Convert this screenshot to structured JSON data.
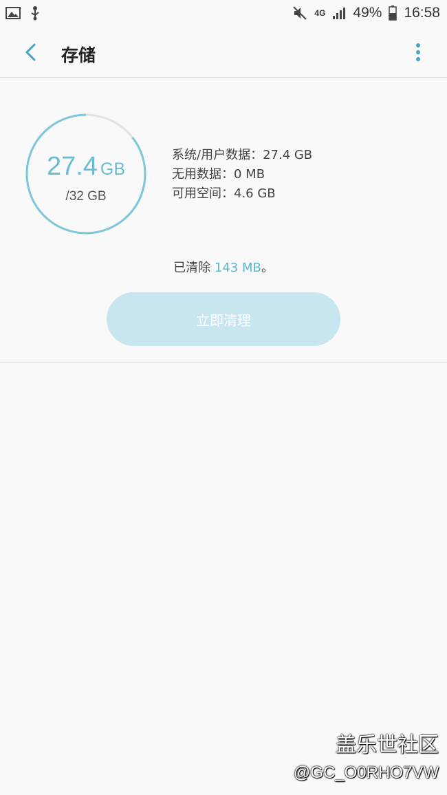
{
  "status_bar": {
    "network": "4G",
    "battery": "49%",
    "time": "16:58",
    "icons": [
      "image-icon",
      "usb-debug-icon",
      "mute-icon",
      "signal-icon",
      "battery-icon"
    ]
  },
  "header": {
    "title": "存储",
    "back_icon": "chevron-left-icon",
    "more_icon": "more-vertical-icon",
    "accent_color": "#4a9fc4"
  },
  "storage": {
    "used_number": "27.4",
    "used_unit": "GB",
    "total": "/32 GB",
    "used_fraction": 0.856,
    "ring_color": "#7ec6db",
    "ring_track_color": "#e2e2e2",
    "details": [
      "系统/用户数据：27.4 GB",
      "无用数据：0 MB",
      "可用空间：4.6 GB"
    ],
    "cleared_prefix": "已清除",
    "cleared_value": " 143 MB",
    "cleared_suffix": "。",
    "clean_button_label": "立即清理"
  },
  "watermark": {
    "line1": "盖乐世社区",
    "line2": "@GC_O0RHO7VW"
  }
}
